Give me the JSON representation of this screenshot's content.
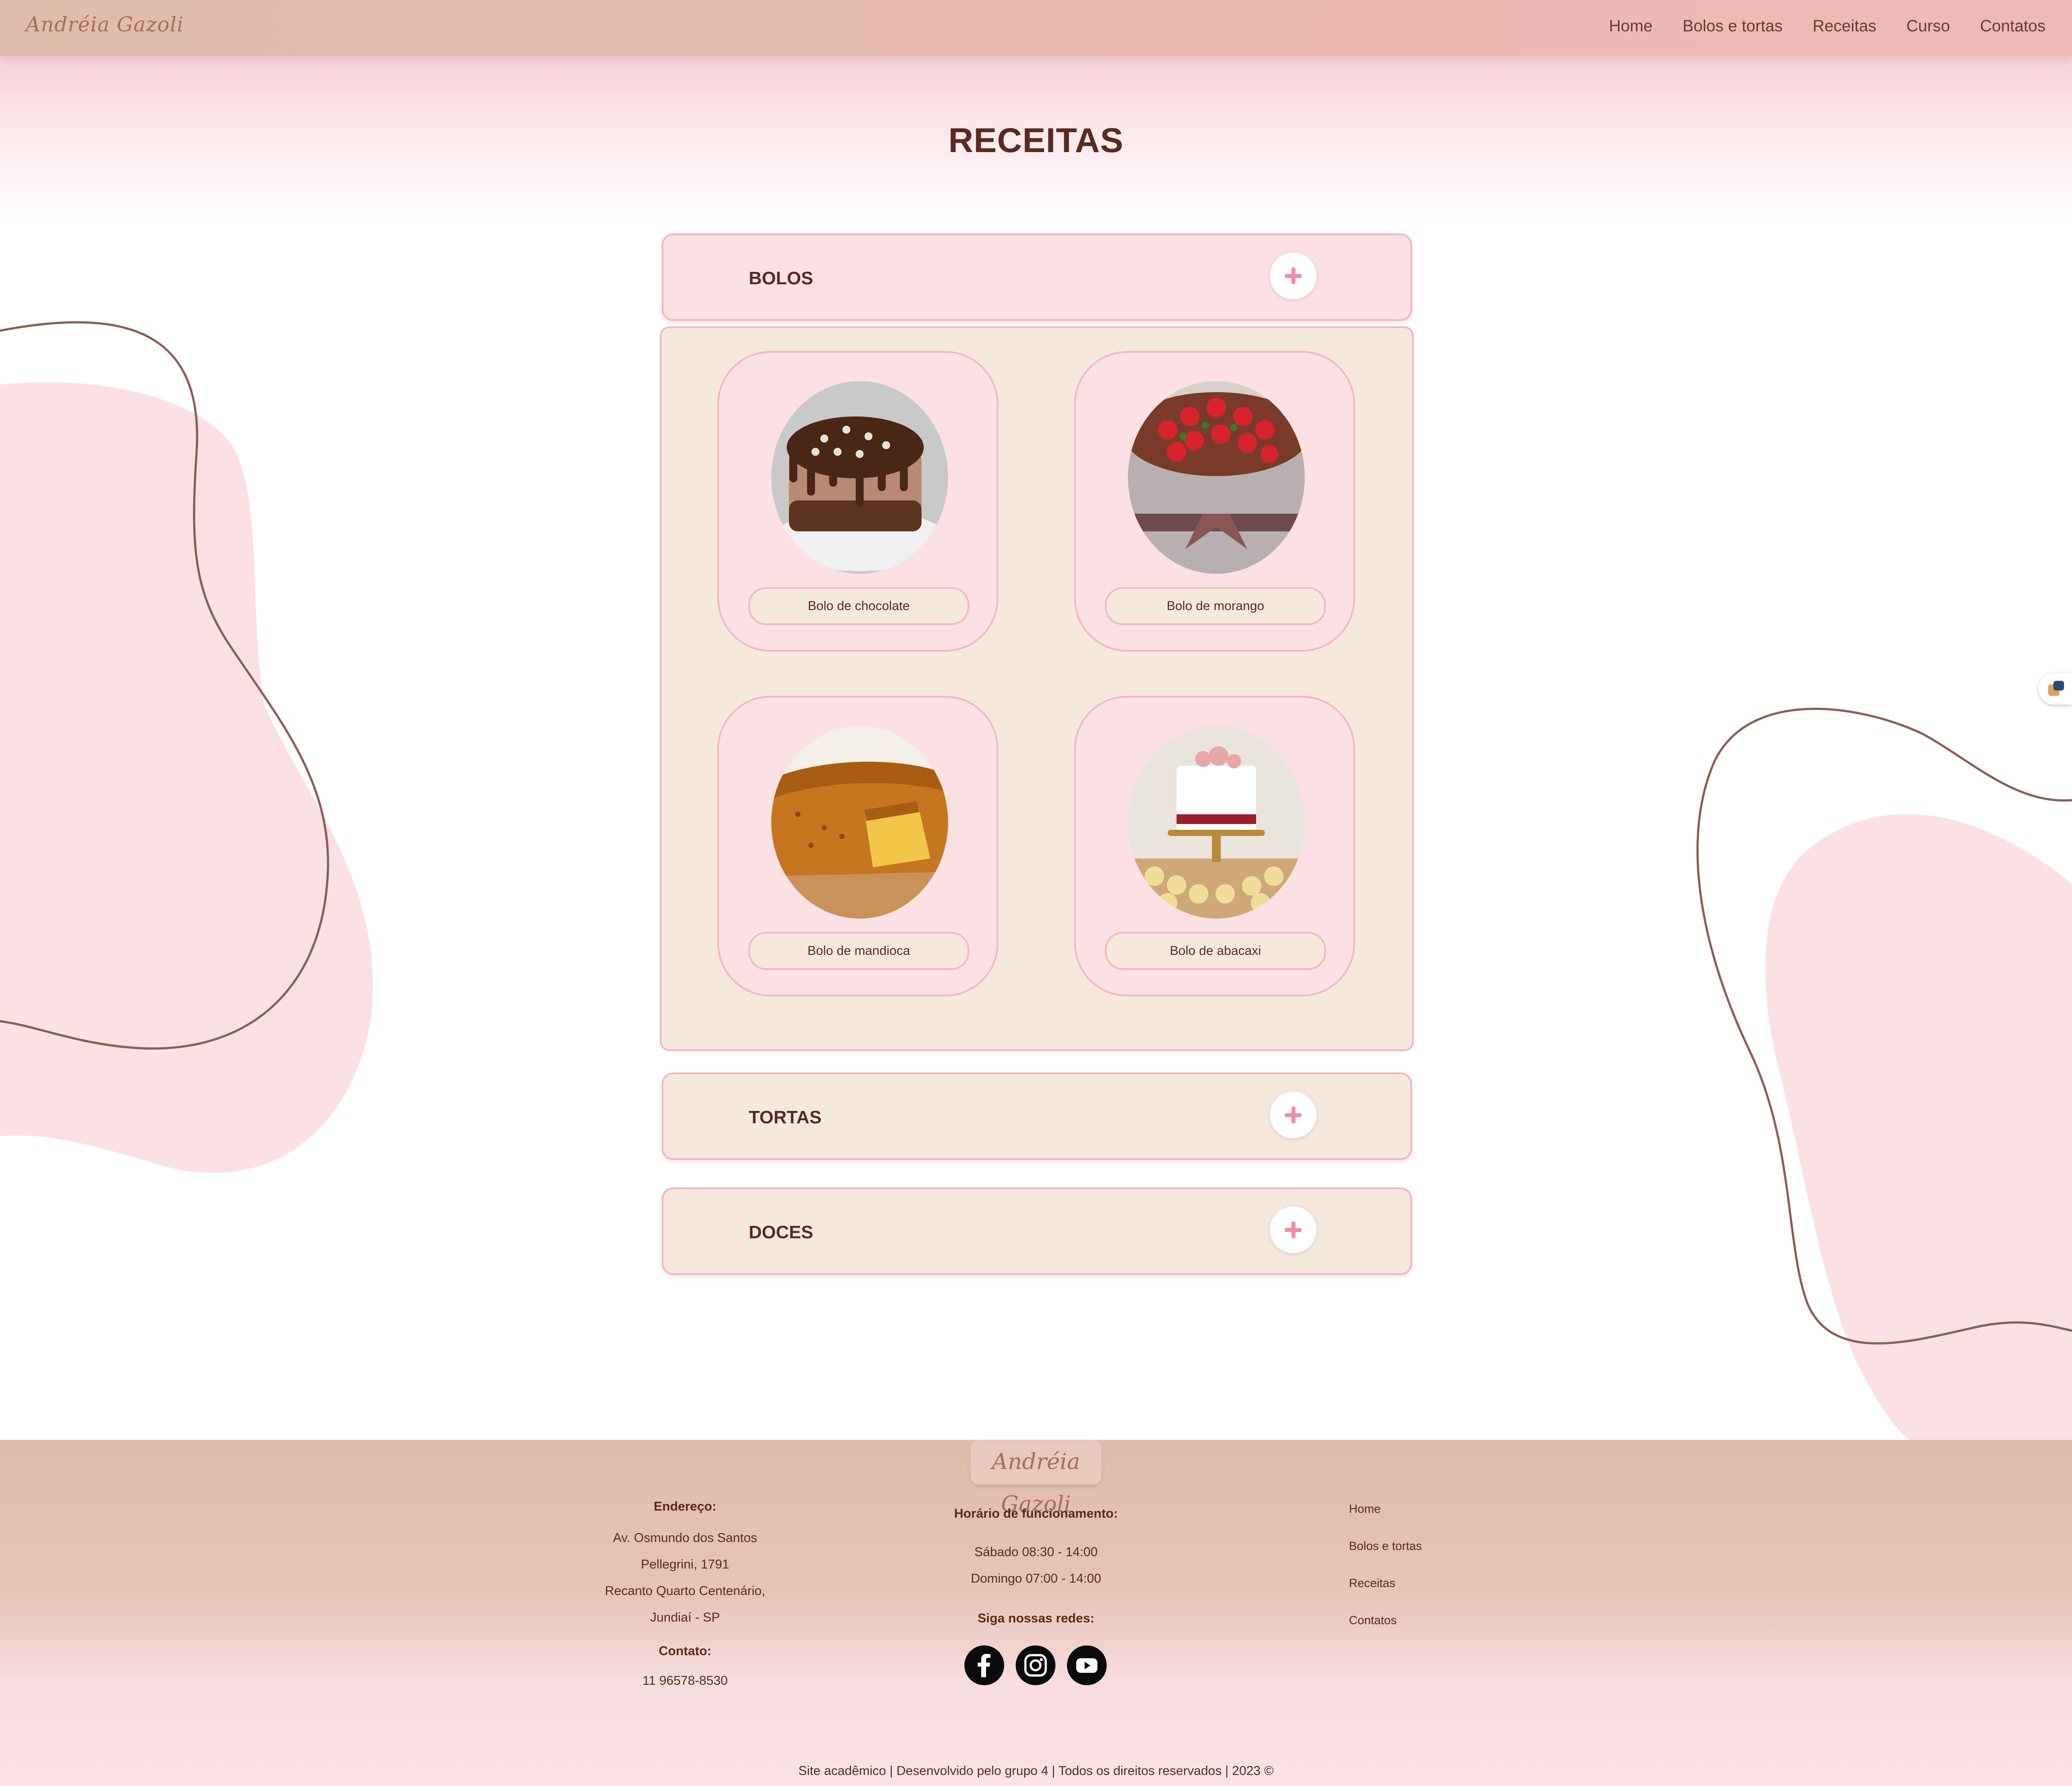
{
  "header": {
    "logo_text": "Andréia Gazoli",
    "nav": [
      "Home",
      "Bolos e tortas",
      "Receitas",
      "Curso",
      "Contatos"
    ]
  },
  "page": {
    "title": "RECEITAS"
  },
  "accordion": {
    "sections": [
      {
        "label": "BOLOS",
        "expanded": true
      },
      {
        "label": "TORTAS",
        "expanded": false
      },
      {
        "label": "DOCES",
        "expanded": false
      }
    ],
    "bolos_items": [
      {
        "label": "Bolo de chocolate",
        "image_icon": "chocolate-cake-image"
      },
      {
        "label": "Bolo de morango",
        "image_icon": "strawberry-cake-image"
      },
      {
        "label": "Bolo de mandioca",
        "image_icon": "cassava-cake-image"
      },
      {
        "label": "Bolo de abacaxi",
        "image_icon": "pineapple-cake-image"
      }
    ]
  },
  "footer": {
    "logo_text": "Andréia Gazoli",
    "address": {
      "title": "Endereço:",
      "lines": [
        "Av. Osmundo dos Santos",
        "Pellegrini, 1791",
        "Recanto Quarto Centenário,",
        "Jundiaí - SP"
      ]
    },
    "contact": {
      "title": "Contato:",
      "phone": "11 96578-8530"
    },
    "hours": {
      "title": "Horário de funcionamento:",
      "lines": [
        "Sábado 08:30 - 14:00",
        "Domingo 07:00 - 14:00"
      ]
    },
    "social": {
      "title": "Siga nossas redes:",
      "icons": [
        "facebook-icon",
        "instagram-icon",
        "youtube-icon"
      ]
    },
    "links": [
      "Home",
      "Bolos e tortas",
      "Receitas",
      "Contatos"
    ],
    "copyright": "Site acadêmico | Desenvolvido pelo grupo 4 | Todos os direitos reservados | 2023 ©"
  },
  "colors": {
    "accent_pink": "#f4b6c2",
    "card_pink": "#fbe1e4",
    "cream": "#f5e9de",
    "text_brown": "#5a2a20",
    "header_tan": "#dfbcab"
  }
}
